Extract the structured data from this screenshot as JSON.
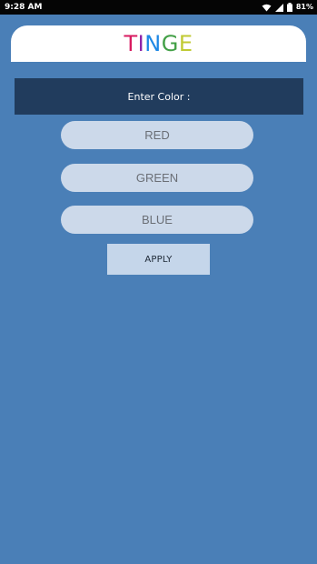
{
  "status_bar": {
    "time": "9:28 AM",
    "battery_percent": "81%",
    "icons": [
      "wifi-icon",
      "signal-icon",
      "battery-icon"
    ]
  },
  "app": {
    "title_letters": [
      {
        "char": "T",
        "color": "#d81b60"
      },
      {
        "char": "I",
        "color": "#8e24aa"
      },
      {
        "char": "N",
        "color": "#1e88e5"
      },
      {
        "char": "G",
        "color": "#43a047"
      },
      {
        "char": "E",
        "color": "#c0ca33"
      }
    ]
  },
  "form": {
    "enter_label": "Enter Color :",
    "red_placeholder": "RED",
    "green_placeholder": "GREEN",
    "blue_placeholder": "BLUE",
    "apply_label": "APPLY"
  },
  "colors": {
    "background": "#4a7fb7",
    "panel": "#213c5d",
    "field": "#ccd9ea",
    "button": "#c5d6ea"
  }
}
